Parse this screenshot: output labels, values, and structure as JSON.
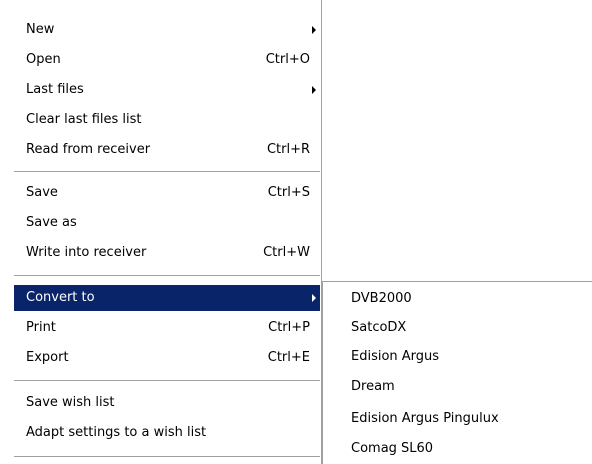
{
  "menu": {
    "new": {
      "label": "New"
    },
    "open": {
      "label": "Open",
      "shortcut": "Ctrl+O"
    },
    "last_files": {
      "label": "Last files"
    },
    "clear_last_files": {
      "label": "Clear last files list"
    },
    "read_from_receiver": {
      "label": "Read from receiver",
      "shortcut": "Ctrl+R"
    },
    "save": {
      "label": "Save",
      "shortcut": "Ctrl+S"
    },
    "save_as": {
      "label": "Save as"
    },
    "write_into_receiver": {
      "label": "Write into receiver",
      "shortcut": "Ctrl+W"
    },
    "convert_to": {
      "label": "Convert to"
    },
    "print": {
      "label": "Print",
      "shortcut": "Ctrl+P"
    },
    "export": {
      "label": "Export",
      "shortcut": "Ctrl+E"
    },
    "save_wish_list": {
      "label": "Save wish list"
    },
    "adapt_settings": {
      "label": "Adapt settings to a wish list"
    }
  },
  "submenu": {
    "items": [
      {
        "label": "DVB2000"
      },
      {
        "label": "SatcoDX"
      },
      {
        "label": "Edision Argus"
      },
      {
        "label": "Dream"
      },
      {
        "label": "Edision Argus Pingulux"
      },
      {
        "label": "Comag SL60"
      }
    ]
  },
  "colors": {
    "highlight_background": "#0a246a",
    "highlight_text": "#ffffff",
    "menu_background": "#ffffff",
    "separator": "#a0a0a0"
  }
}
